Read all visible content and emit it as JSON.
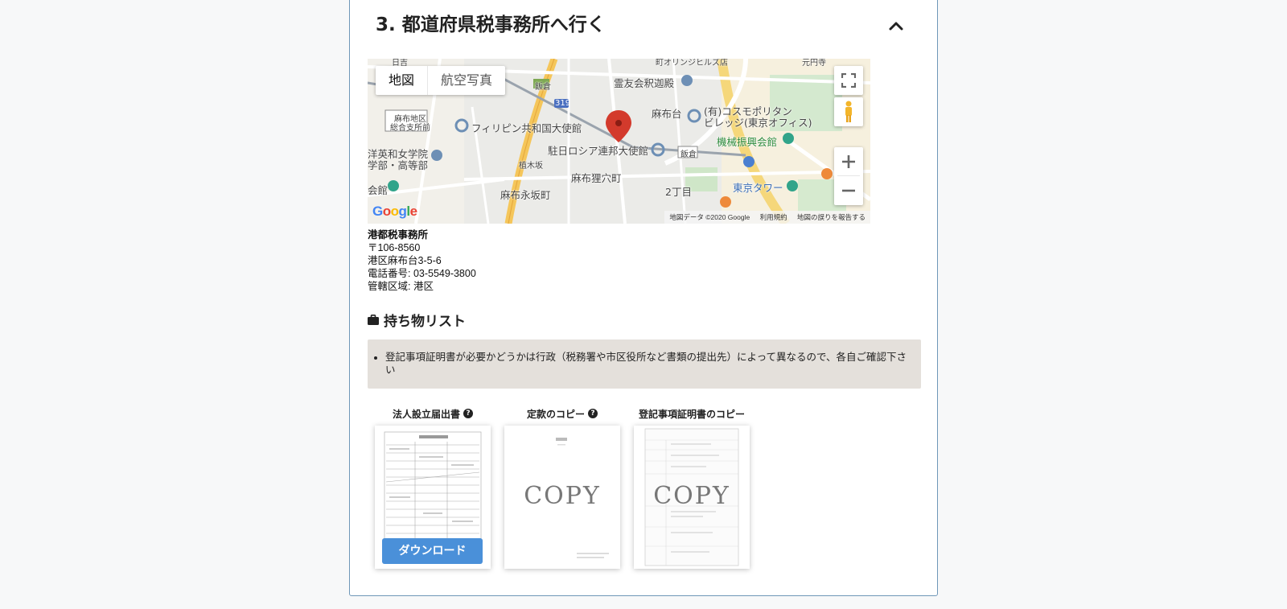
{
  "section": {
    "title": "3. 都道府県税事務所へ行く"
  },
  "map": {
    "type_buttons": [
      "地図",
      "航空写真"
    ],
    "labels": {
      "reiyukai": "霊友会釈迦殿",
      "azabudai": "麻布台",
      "cosmopolitan": "(有)コスモポリタン",
      "cosmopolitan2": "ビレッジ(東京オフィス)",
      "philippine": "フィリピン共和国大使館",
      "russia": "駐日ロシア連邦大使館",
      "kikai": "機械振興会館",
      "tokyotower": "東京タワー",
      "mamiana": "麻布狸穴町",
      "nagasaka": "麻布永坂町",
      "nichome": "2丁目",
      "iikura1": "飯倉",
      "iikura2": "飯倉",
      "minatochiku": "麻布地区",
      "minatochiku2": "総合支所前",
      "toyoeiwa": "洋英和女学院",
      "toyoeiwa2": "学部・高等部",
      "kan": "会館",
      "route": "319",
      "narukizaka": "植木坂",
      "top1": "町オリンジヒルズ店",
      "top2": "元円寺",
      "top3": "日吉"
    },
    "logo": "Google",
    "footer": [
      "地図データ ©2020 Google",
      "利用規約",
      "地図の誤りを報告する"
    ]
  },
  "office": {
    "name": "港都税事務所",
    "postal": "〒106-8560",
    "address": "港区麻布台3-5-6",
    "phone": "電話番号: 03-5549-3800",
    "jurisdiction": "管轄区域: 港区"
  },
  "checklist": {
    "title": "持ち物リスト",
    "note": "登記事項証明書が必要かどうかは行政（税務署や市区役所など書類の提出先）によって異なるので、各自ご確認下さい"
  },
  "documents": [
    {
      "label": "法人設立届出書",
      "has_help": true,
      "button": "ダウンロード"
    },
    {
      "label": "定款のコピー",
      "has_help": true,
      "stamp": "COPY"
    },
    {
      "label": "登記事項証明書のコピー",
      "has_help": false,
      "stamp": "COPY"
    }
  ],
  "colors": {
    "panel_border": "#6f97b8",
    "note_bg": "#e4e0db",
    "download_button": "#4a90d9",
    "map_pin": "#d33a2c"
  }
}
